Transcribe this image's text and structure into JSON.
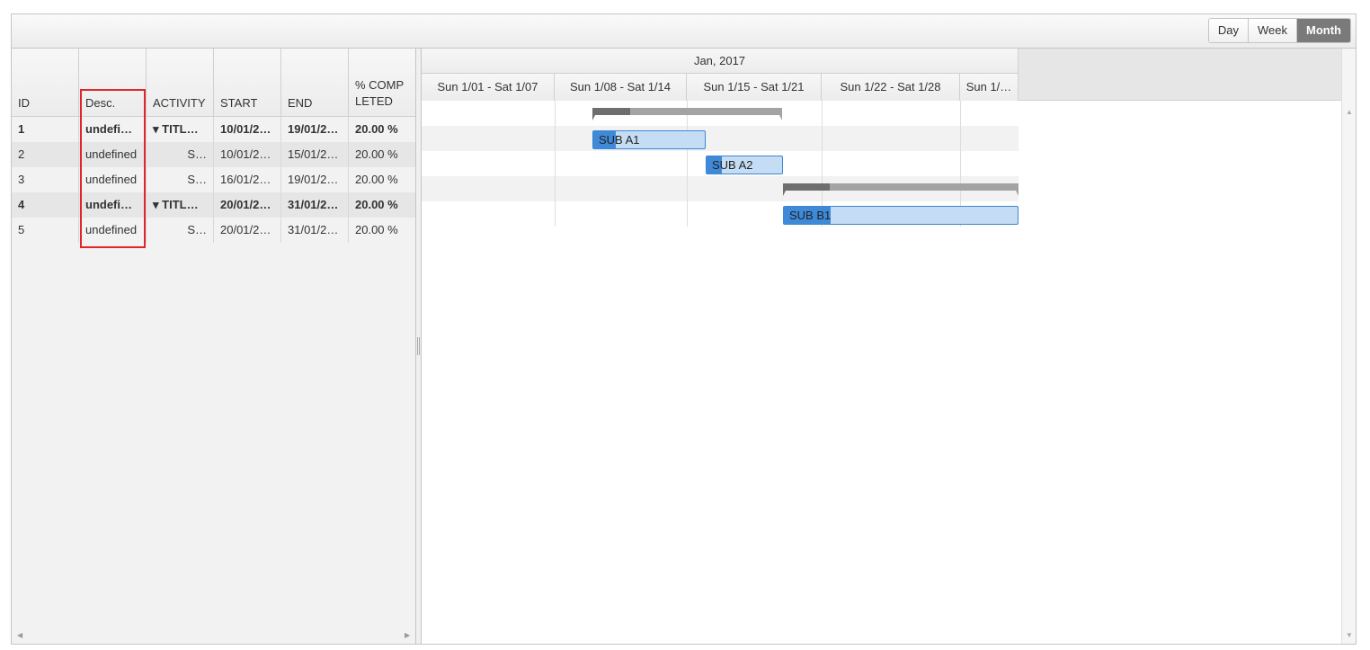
{
  "toolbar": {
    "views": [
      {
        "label": "Day",
        "selected": false
      },
      {
        "label": "Week",
        "selected": false
      },
      {
        "label": "Month",
        "selected": true
      }
    ]
  },
  "grid": {
    "columns": [
      "ID",
      "Desc.",
      "ACTIVITY",
      "START",
      "END",
      "% COMPLETED"
    ],
    "rows": [
      {
        "id": "1",
        "desc": "undefi…",
        "activity": "▾ TITL…",
        "start": "10/01/2…",
        "end": "19/01/2…",
        "complete": "20.00 %",
        "bold": true
      },
      {
        "id": "2",
        "desc": "undefined",
        "activity": "S…",
        "start": "10/01/2…",
        "end": "15/01/2…",
        "complete": "20.00 %",
        "bold": false
      },
      {
        "id": "3",
        "desc": "undefined",
        "activity": "S…",
        "start": "16/01/2…",
        "end": "19/01/2…",
        "complete": "20.00 %",
        "bold": false
      },
      {
        "id": "4",
        "desc": "undefi…",
        "activity": "▾ TITL…",
        "start": "20/01/2…",
        "end": "31/01/2…",
        "complete": "20.00 %",
        "bold": true
      },
      {
        "id": "5",
        "desc": "undefined",
        "activity": "S…",
        "start": "20/01/2…",
        "end": "31/01/2…",
        "complete": "20.00 %",
        "bold": false
      }
    ]
  },
  "timeline": {
    "month": "Jan, 2017",
    "weeks": [
      "Sun 1/01 - Sat 1/07",
      "Sun 1/08 - Sat 1/14",
      "Sun 1/15 - Sat 1/21",
      "Sun 1/22 - Sat 1/28",
      "Sun 1/…"
    ],
    "tasks": [
      {
        "label": "SUB A1",
        "progress": 0.2
      },
      {
        "label": "SUB A2",
        "progress": 0.2
      },
      {
        "label": "SUB B1",
        "progress": 0.2
      }
    ],
    "summaries": [
      {
        "progress": 0.2
      },
      {
        "progress": 0.2
      }
    ]
  }
}
